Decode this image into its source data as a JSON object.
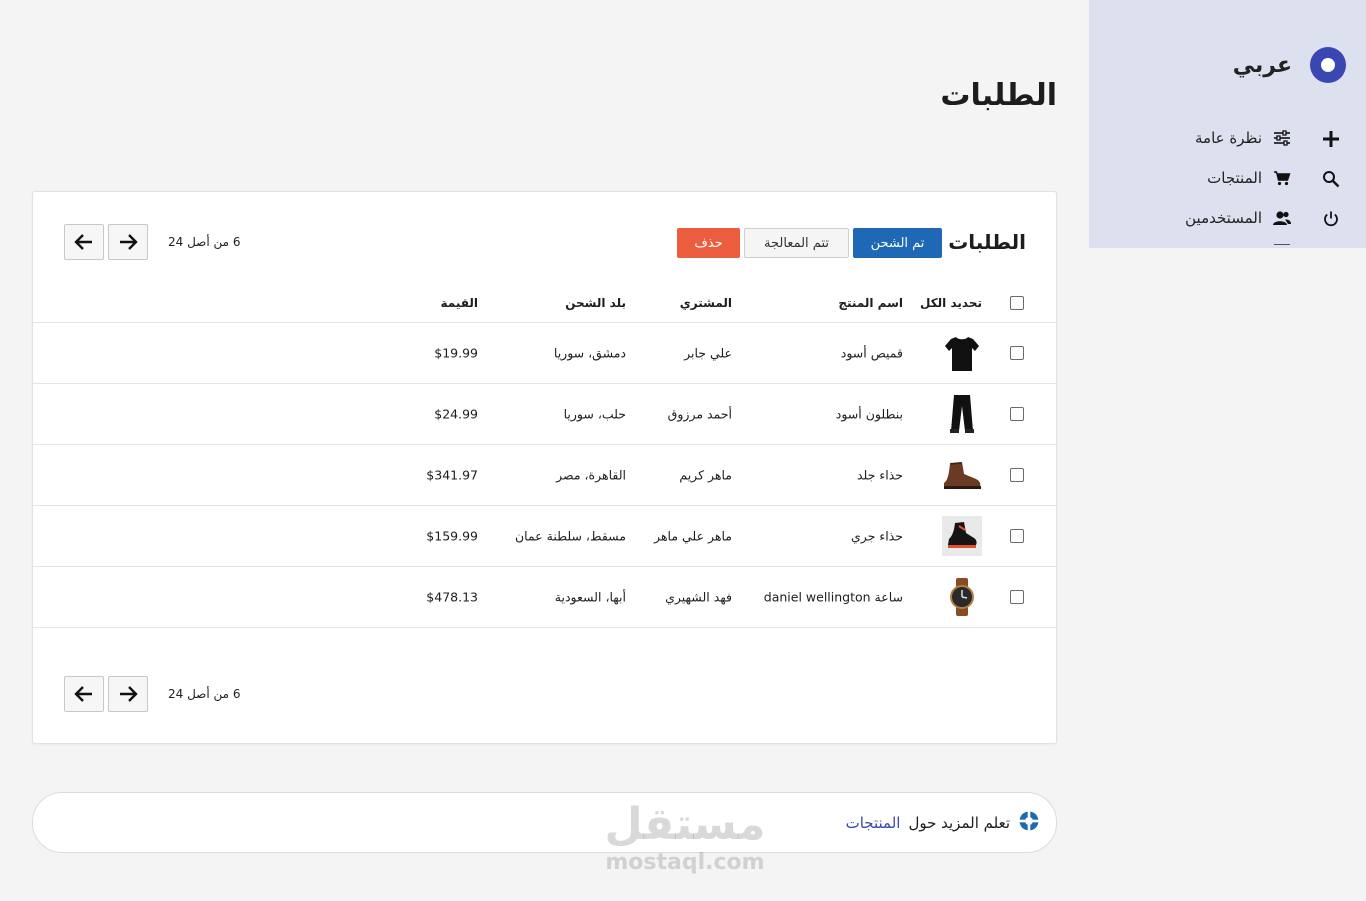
{
  "brand": {
    "name": "عربي",
    "accent": "#3a46b2"
  },
  "sidebar": {
    "background": "#dde0ef",
    "rail_icons": [
      "plus-icon",
      "search-icon",
      "power-icon"
    ],
    "items": [
      {
        "label": "نظرة عامة",
        "icon": "sliders-icon"
      },
      {
        "label": "المنتجات",
        "icon": "cart-icon"
      },
      {
        "label": "المستخدمين",
        "icon": "users-icon"
      }
    ]
  },
  "page": {
    "title": "الطلبات"
  },
  "orders_card": {
    "title": "الطلبات",
    "actions": {
      "shipped": "تم الشحن",
      "processing": "تتم المعالجة",
      "delete": "حذف"
    },
    "action_colors": {
      "shipped": "#1e68b5",
      "delete": "#eb5d3e"
    },
    "pagination": {
      "text": "6 من أصل 24"
    },
    "columns": {
      "select_all": "تحديد الكل",
      "product": "اسم المنتج",
      "buyer": "المشتري",
      "country": "بلد الشحن",
      "price": "القيمة"
    },
    "rows": [
      {
        "product": "قميص أسود",
        "thumb": "shirt-icon",
        "buyer": "علي جابر",
        "country": "دمشق، سوريا",
        "price": "$19.99"
      },
      {
        "product": "بنطلون أسود",
        "thumb": "pants-icon",
        "buyer": "أحمد مرزوق",
        "country": "حلب، سوريا",
        "price": "$24.99"
      },
      {
        "product": "حذاء جلد",
        "thumb": "boot-icon",
        "buyer": "ماهر كريم",
        "country": "القاهرة، مصر",
        "price": "$341.97"
      },
      {
        "product": "حذاء جري",
        "thumb": "sneaker-icon",
        "buyer": "ماهر علي ماهر",
        "country": "مسقط، سلطنة عمان",
        "price": "$159.99"
      },
      {
        "product": "ساعة daniel wellington",
        "thumb": "watch-icon",
        "buyer": "فهد الشهيري",
        "country": "أبها، السعودية",
        "price": "$478.13"
      }
    ]
  },
  "learn_more": {
    "prefix": "تعلم المزيد حول",
    "link": "المنتجات",
    "icon": "lifebuoy-icon"
  },
  "watermark": {
    "arabic": "مستقل",
    "latin": "mostaql.com"
  }
}
